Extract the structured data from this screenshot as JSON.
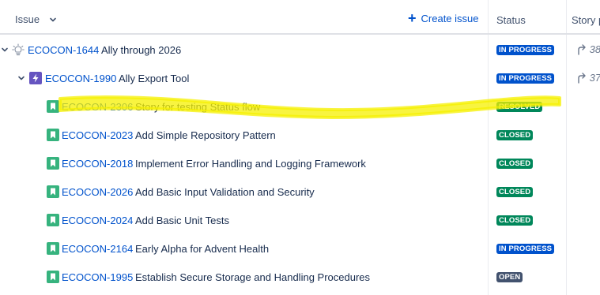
{
  "header": {
    "issue_label": "Issue",
    "create_issue_label": "Create issue",
    "status_label": "Status",
    "story_label": "Story p"
  },
  "rows": [
    {
      "key": "ECOCON-1644",
      "summary": "Ally through 2026",
      "status": "IN PROGRESS",
      "icon": "lightbulb-icon",
      "story": "38"
    },
    {
      "key": "ECOCON-1990",
      "summary": "Ally Export Tool",
      "status": "IN PROGRESS",
      "icon": "epic-lightning-icon",
      "story": "37"
    },
    {
      "key": "ECOCON-2306",
      "summary": "Story for testing Status flow",
      "status": "RESOLVED",
      "icon": "story-bookmark-icon"
    },
    {
      "key": "ECOCON-2023",
      "summary": "Add Simple Repository Pattern",
      "status": "CLOSED",
      "icon": "story-bookmark-icon"
    },
    {
      "key": "ECOCON-2018",
      "summary": "Implement Error Handling and Logging Framework",
      "status": "CLOSED",
      "icon": "story-bookmark-icon"
    },
    {
      "key": "ECOCON-2026",
      "summary": "Add Basic Input Validation and Security",
      "status": "CLOSED",
      "icon": "story-bookmark-icon"
    },
    {
      "key": "ECOCON-2024",
      "summary": "Add Basic Unit Tests",
      "status": "CLOSED",
      "icon": "story-bookmark-icon"
    },
    {
      "key": "ECOCON-2164",
      "summary": "Early Alpha for Advent Health",
      "status": "IN PROGRESS",
      "icon": "story-bookmark-icon"
    },
    {
      "key": "ECOCON-1995",
      "summary": "Establish Secure Storage and Handling Procedures",
      "status": "OPEN",
      "icon": "story-bookmark-icon"
    }
  ],
  "colors": {
    "link": "#0052cc",
    "in_progress": "#0052cc",
    "closed": "#00875a",
    "open": "#42526e",
    "story_icon": "#36b37e",
    "epic_icon": "#6554c0",
    "highlight": "#f5f000"
  }
}
